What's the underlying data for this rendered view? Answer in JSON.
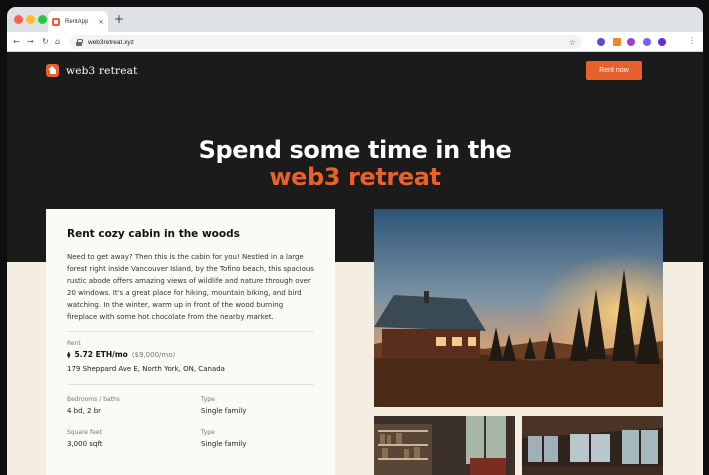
{
  "browser": {
    "tab_title": "RentApp",
    "tab_close": "×",
    "new_tab": "+",
    "url": "web3retreat.xyz",
    "nav": {
      "back": "←",
      "forward": "→",
      "reload": "↻",
      "home": "⌂"
    },
    "star": "☆",
    "menu": "⋮"
  },
  "header": {
    "logo_text": "web3 retreat",
    "logo_icon": "home-icon",
    "cta_label": "Rent now"
  },
  "hero": {
    "line1": "Spend some time in the",
    "line2": "web3 retreat"
  },
  "listing": {
    "title": "Rent cozy cabin in the woods",
    "description": "Need to get away?  Then this is the cabin for you! Nestled in a large forest right inside Vancouver Island, by the Tofino beach, this spacious rustic abode offers amazing views of wildlife and nature through over 20 windows. It's a great place for hiking, mountain biking, and bird watching. In the winter, warm up in front of the wood burning fireplace with some hot chocolate from the nearby market.",
    "rent_label": "Rent",
    "price": "5.72 ETH/mo",
    "price_usd": "($9,000/mo)",
    "address": "179 Sheppard Ave E, North York, ON, Canada",
    "details": [
      {
        "label": "Bedrooms / baths",
        "value": "4 bd, 2 br"
      },
      {
        "label": "Type",
        "value": "Single family"
      },
      {
        "label": "Square feet",
        "value": "3,000 sqft"
      },
      {
        "label": "Type",
        "value": "Single family"
      }
    ]
  },
  "colors": {
    "accent": "#e8612c",
    "dark_bg": "#1b1b1b",
    "cream_bg": "#f4ede1"
  }
}
